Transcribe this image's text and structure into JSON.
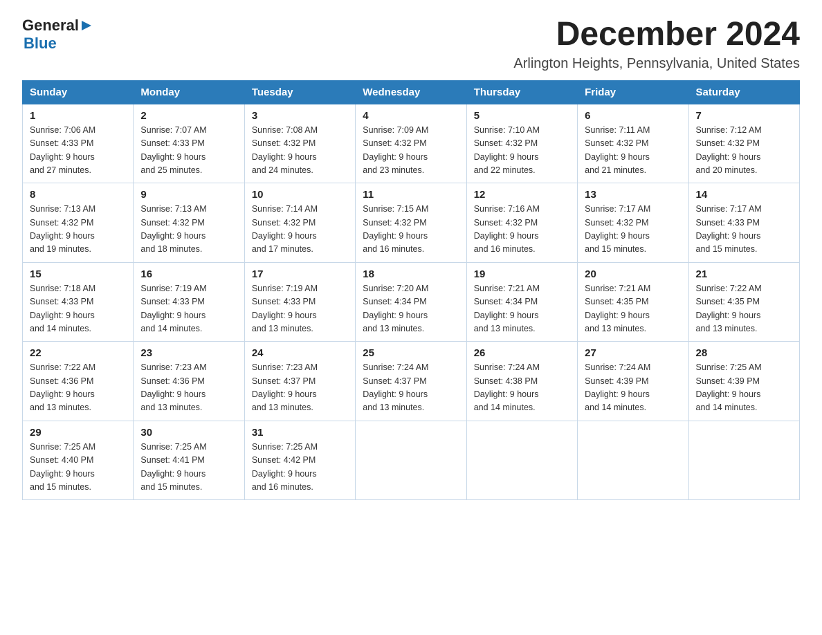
{
  "logo": {
    "general": "General",
    "blue": "Blue",
    "arrow": "▶"
  },
  "title": "December 2024",
  "location": "Arlington Heights, Pennsylvania, United States",
  "weekdays": [
    "Sunday",
    "Monday",
    "Tuesday",
    "Wednesday",
    "Thursday",
    "Friday",
    "Saturday"
  ],
  "weeks": [
    [
      {
        "day": "1",
        "sunrise": "7:06 AM",
        "sunset": "4:33 PM",
        "daylight": "9 hours and 27 minutes."
      },
      {
        "day": "2",
        "sunrise": "7:07 AM",
        "sunset": "4:33 PM",
        "daylight": "9 hours and 25 minutes."
      },
      {
        "day": "3",
        "sunrise": "7:08 AM",
        "sunset": "4:32 PM",
        "daylight": "9 hours and 24 minutes."
      },
      {
        "day": "4",
        "sunrise": "7:09 AM",
        "sunset": "4:32 PM",
        "daylight": "9 hours and 23 minutes."
      },
      {
        "day": "5",
        "sunrise": "7:10 AM",
        "sunset": "4:32 PM",
        "daylight": "9 hours and 22 minutes."
      },
      {
        "day": "6",
        "sunrise": "7:11 AM",
        "sunset": "4:32 PM",
        "daylight": "9 hours and 21 minutes."
      },
      {
        "day": "7",
        "sunrise": "7:12 AM",
        "sunset": "4:32 PM",
        "daylight": "9 hours and 20 minutes."
      }
    ],
    [
      {
        "day": "8",
        "sunrise": "7:13 AM",
        "sunset": "4:32 PM",
        "daylight": "9 hours and 19 minutes."
      },
      {
        "day": "9",
        "sunrise": "7:13 AM",
        "sunset": "4:32 PM",
        "daylight": "9 hours and 18 minutes."
      },
      {
        "day": "10",
        "sunrise": "7:14 AM",
        "sunset": "4:32 PM",
        "daylight": "9 hours and 17 minutes."
      },
      {
        "day": "11",
        "sunrise": "7:15 AM",
        "sunset": "4:32 PM",
        "daylight": "9 hours and 16 minutes."
      },
      {
        "day": "12",
        "sunrise": "7:16 AM",
        "sunset": "4:32 PM",
        "daylight": "9 hours and 16 minutes."
      },
      {
        "day": "13",
        "sunrise": "7:17 AM",
        "sunset": "4:32 PM",
        "daylight": "9 hours and 15 minutes."
      },
      {
        "day": "14",
        "sunrise": "7:17 AM",
        "sunset": "4:33 PM",
        "daylight": "9 hours and 15 minutes."
      }
    ],
    [
      {
        "day": "15",
        "sunrise": "7:18 AM",
        "sunset": "4:33 PM",
        "daylight": "9 hours and 14 minutes."
      },
      {
        "day": "16",
        "sunrise": "7:19 AM",
        "sunset": "4:33 PM",
        "daylight": "9 hours and 14 minutes."
      },
      {
        "day": "17",
        "sunrise": "7:19 AM",
        "sunset": "4:33 PM",
        "daylight": "9 hours and 13 minutes."
      },
      {
        "day": "18",
        "sunrise": "7:20 AM",
        "sunset": "4:34 PM",
        "daylight": "9 hours and 13 minutes."
      },
      {
        "day": "19",
        "sunrise": "7:21 AM",
        "sunset": "4:34 PM",
        "daylight": "9 hours and 13 minutes."
      },
      {
        "day": "20",
        "sunrise": "7:21 AM",
        "sunset": "4:35 PM",
        "daylight": "9 hours and 13 minutes."
      },
      {
        "day": "21",
        "sunrise": "7:22 AM",
        "sunset": "4:35 PM",
        "daylight": "9 hours and 13 minutes."
      }
    ],
    [
      {
        "day": "22",
        "sunrise": "7:22 AM",
        "sunset": "4:36 PM",
        "daylight": "9 hours and 13 minutes."
      },
      {
        "day": "23",
        "sunrise": "7:23 AM",
        "sunset": "4:36 PM",
        "daylight": "9 hours and 13 minutes."
      },
      {
        "day": "24",
        "sunrise": "7:23 AM",
        "sunset": "4:37 PM",
        "daylight": "9 hours and 13 minutes."
      },
      {
        "day": "25",
        "sunrise": "7:24 AM",
        "sunset": "4:37 PM",
        "daylight": "9 hours and 13 minutes."
      },
      {
        "day": "26",
        "sunrise": "7:24 AM",
        "sunset": "4:38 PM",
        "daylight": "9 hours and 14 minutes."
      },
      {
        "day": "27",
        "sunrise": "7:24 AM",
        "sunset": "4:39 PM",
        "daylight": "9 hours and 14 minutes."
      },
      {
        "day": "28",
        "sunrise": "7:25 AM",
        "sunset": "4:39 PM",
        "daylight": "9 hours and 14 minutes."
      }
    ],
    [
      {
        "day": "29",
        "sunrise": "7:25 AM",
        "sunset": "4:40 PM",
        "daylight": "9 hours and 15 minutes."
      },
      {
        "day": "30",
        "sunrise": "7:25 AM",
        "sunset": "4:41 PM",
        "daylight": "9 hours and 15 minutes."
      },
      {
        "day": "31",
        "sunrise": "7:25 AM",
        "sunset": "4:42 PM",
        "daylight": "9 hours and 16 minutes."
      },
      null,
      null,
      null,
      null
    ]
  ],
  "labels": {
    "sunrise": "Sunrise:",
    "sunset": "Sunset:",
    "daylight": "Daylight:"
  }
}
